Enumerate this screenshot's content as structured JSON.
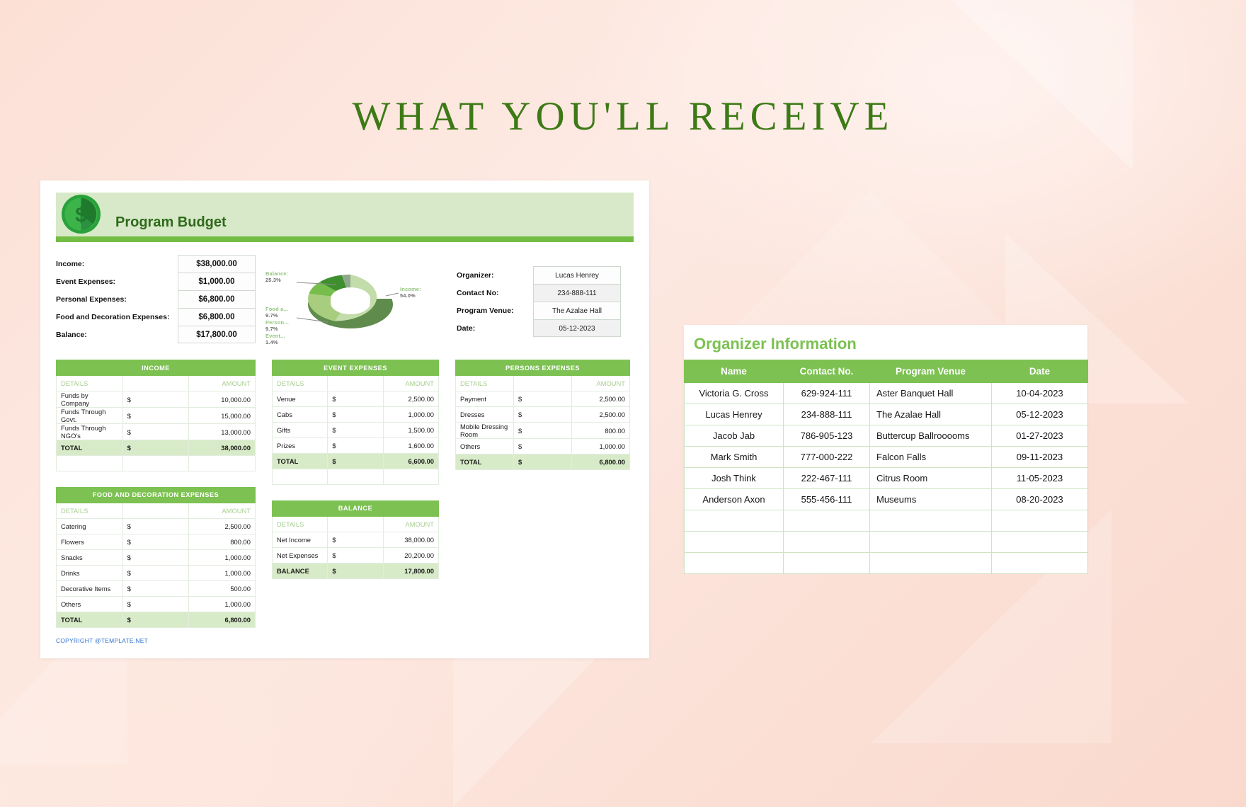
{
  "page": {
    "title": "WHAT YOU'LL RECEIVE",
    "accent_green": "#7cc151",
    "title_green": "#3d7a16",
    "background": "#fbe3da"
  },
  "sheet": {
    "header": {
      "title": "Program Budget",
      "icon": "dollar-coin-icon"
    },
    "summary": [
      {
        "label": "Income:",
        "value": "$38,000.00"
      },
      {
        "label": "Event Expenses:",
        "value": "$1,000.00"
      },
      {
        "label": "Personal Expenses:",
        "value": "$6,800.00"
      },
      {
        "label": "Food and Decoration Expenses:",
        "value": "$6,800.00"
      },
      {
        "label": "Balance:",
        "value": "$17,800.00"
      }
    ],
    "organizer_fields": [
      {
        "label": "Organizer:",
        "value": "Lucas Henrey"
      },
      {
        "label": "Contact No:",
        "value": "234-888-111"
      },
      {
        "label": "Program Venue:",
        "value": "The Azalae Hall"
      },
      {
        "label": "Date:",
        "value": "05-12-2023"
      }
    ],
    "tables": {
      "income": {
        "caption": "INCOME",
        "col_details": "DETAILS",
        "col_amount": "AMOUNT",
        "currency": "$",
        "rows": [
          {
            "details": "Funds by Company",
            "amount": "10,000.00"
          },
          {
            "details": "Funds Through Govt.",
            "amount": "15,000.00"
          },
          {
            "details": "Funds Through NGO's",
            "amount": "13,000.00"
          }
        ],
        "total_label": "TOTAL",
        "total_amount": "38,000.00"
      },
      "food": {
        "caption": "FOOD AND DECORATION EXPENSES",
        "col_details": "DETAILS",
        "col_amount": "AMOUNT",
        "currency": "$",
        "rows": [
          {
            "details": "Catering",
            "amount": "2,500.00"
          },
          {
            "details": "Flowers",
            "amount": "800.00"
          },
          {
            "details": "Snacks",
            "amount": "1,000.00"
          },
          {
            "details": "Drinks",
            "amount": "1,000.00"
          },
          {
            "details": "Decorative Items",
            "amount": "500.00"
          },
          {
            "details": "Others",
            "amount": "1,000.00"
          }
        ],
        "total_label": "TOTAL",
        "total_amount": "6,800.00"
      },
      "event": {
        "caption": "EVENT EXPENSES",
        "col_details": "DETAILS",
        "col_amount": "AMOUNT",
        "currency": "$",
        "rows": [
          {
            "details": "Venue",
            "amount": "2,500.00"
          },
          {
            "details": "Cabs",
            "amount": "1,000.00"
          },
          {
            "details": "Gifts",
            "amount": "1,500.00"
          },
          {
            "details": "Prizes",
            "amount": "1,600.00"
          }
        ],
        "total_label": "TOTAL",
        "total_amount": "6,600.00"
      },
      "balance": {
        "caption": "BALANCE",
        "col_details": "DETAILS",
        "col_amount": "AMOUNT",
        "currency": "$",
        "rows": [
          {
            "details": "Net Income",
            "amount": "38,000.00"
          },
          {
            "details": "Net Expenses",
            "amount": "20,200.00"
          }
        ],
        "total_label": "BALANCE",
        "total_amount": "17,800.00"
      },
      "persons": {
        "caption": "PERSONS EXPENSES",
        "col_details": "DETAILS",
        "col_amount": "AMOUNT",
        "currency": "$",
        "rows": [
          {
            "details": "Payment",
            "amount": "2,500.00"
          },
          {
            "details": "Dresses",
            "amount": "2,500.00"
          },
          {
            "details": "Mobile Dressing Room",
            "amount": "800.00"
          },
          {
            "details": "Others",
            "amount": "1,000.00"
          }
        ],
        "total_label": "TOTAL",
        "total_amount": "6,800.00"
      }
    },
    "copyright": "COPYRIGHT @TEMPLATE.NET"
  },
  "chart_data": {
    "type": "pie",
    "title": "",
    "donut": true,
    "legend_position": "callout-labels",
    "labels": [
      "Income",
      "Balance",
      "Food a...",
      "Person...",
      "Event..."
    ],
    "full_labels": [
      "Income",
      "Balance",
      "Food and Decoration Expenses",
      "Personal Expenses",
      "Event Expenses"
    ],
    "values": [
      54.0,
      25.3,
      9.7,
      9.7,
      1.4
    ],
    "value_labels": [
      "54.0%",
      "25.3%",
      "9.7%",
      "9.7%",
      "1.4%"
    ],
    "colors": [
      "#c2dcaa",
      "#a8cd7e",
      "#76bd4b",
      "#3f8f2e",
      "#8fa88a"
    ],
    "callouts": [
      {
        "key": "Balance:",
        "value": "25.3%"
      },
      {
        "key": "Food a...",
        "value": "9.7%"
      },
      {
        "key": "Person...",
        "value": "9.7%"
      },
      {
        "key": "Event...",
        "value": "1.4%"
      },
      {
        "key": "Income:",
        "value": "54.0%"
      }
    ]
  },
  "organizer_card": {
    "title": "Organizer Information",
    "columns": [
      "Name",
      "Contact No.",
      "Program Venue",
      "Date"
    ],
    "rows": [
      {
        "name": "Victoria G. Cross",
        "contact": "629-924-111",
        "venue": "Aster Banquet Hall",
        "date": "10-04-2023"
      },
      {
        "name": "Lucas Henrey",
        "contact": "234-888-111",
        "venue": "The Azalae Hall",
        "date": "05-12-2023"
      },
      {
        "name": "Jacob Jab",
        "contact": "786-905-123",
        "venue": "Buttercup Ballrooooms",
        "date": "01-27-2023"
      },
      {
        "name": "Mark Smith",
        "contact": "777-000-222",
        "venue": "Falcon Falls",
        "date": "09-11-2023"
      },
      {
        "name": "Josh Think",
        "contact": "222-467-111",
        "venue": "Citrus Room",
        "date": "11-05-2023"
      },
      {
        "name": "Anderson Axon",
        "contact": "555-456-111",
        "venue": "Museums",
        "date": "08-20-2023"
      },
      {
        "name": "",
        "contact": "",
        "venue": "",
        "date": ""
      },
      {
        "name": "",
        "contact": "",
        "venue": "",
        "date": ""
      },
      {
        "name": "",
        "contact": "",
        "venue": "",
        "date": ""
      }
    ]
  }
}
